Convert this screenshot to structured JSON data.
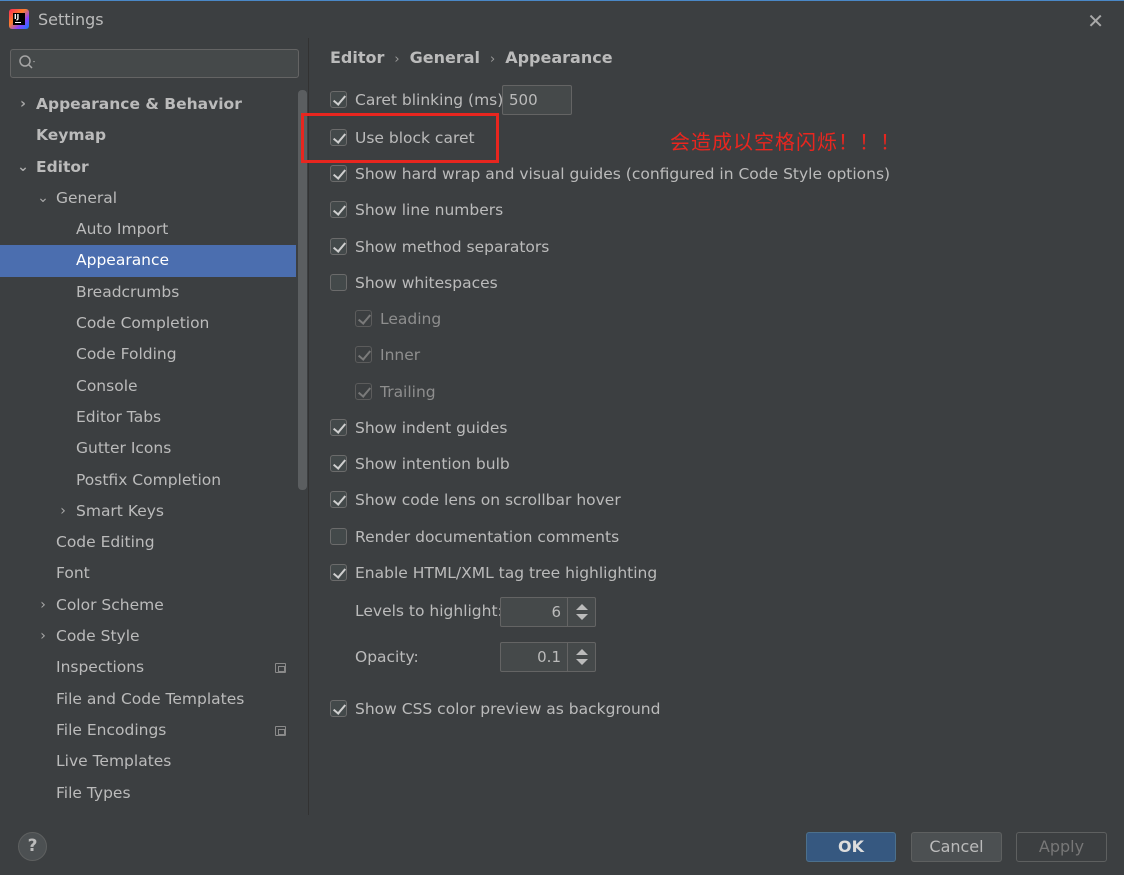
{
  "window": {
    "title": "Settings",
    "close": "✕"
  },
  "search": {
    "placeholder": "",
    "icon": "search-icon"
  },
  "tree": [
    {
      "label": "Appearance & Behavior",
      "indent": 0,
      "arrow": "›",
      "bold": true,
      "selected": false,
      "projicon": false
    },
    {
      "label": "Keymap",
      "indent": 0,
      "arrow": "",
      "bold": true,
      "selected": false,
      "projicon": false
    },
    {
      "label": "Editor",
      "indent": 0,
      "arrow": "⌄",
      "bold": true,
      "selected": false,
      "projicon": false
    },
    {
      "label": "General",
      "indent": 1,
      "arrow": "⌄",
      "bold": false,
      "selected": false,
      "projicon": false
    },
    {
      "label": "Auto Import",
      "indent": 2,
      "arrow": "",
      "bold": false,
      "selected": false,
      "projicon": false
    },
    {
      "label": "Appearance",
      "indent": 2,
      "arrow": "",
      "bold": false,
      "selected": true,
      "projicon": false
    },
    {
      "label": "Breadcrumbs",
      "indent": 2,
      "arrow": "",
      "bold": false,
      "selected": false,
      "projicon": false
    },
    {
      "label": "Code Completion",
      "indent": 2,
      "arrow": "",
      "bold": false,
      "selected": false,
      "projicon": false
    },
    {
      "label": "Code Folding",
      "indent": 2,
      "arrow": "",
      "bold": false,
      "selected": false,
      "projicon": false
    },
    {
      "label": "Console",
      "indent": 2,
      "arrow": "",
      "bold": false,
      "selected": false,
      "projicon": false
    },
    {
      "label": "Editor Tabs",
      "indent": 2,
      "arrow": "",
      "bold": false,
      "selected": false,
      "projicon": false
    },
    {
      "label": "Gutter Icons",
      "indent": 2,
      "arrow": "",
      "bold": false,
      "selected": false,
      "projicon": false
    },
    {
      "label": "Postfix Completion",
      "indent": 2,
      "arrow": "",
      "bold": false,
      "selected": false,
      "projicon": false
    },
    {
      "label": "Smart Keys",
      "indent": 2,
      "arrow": "›",
      "bold": false,
      "selected": false,
      "projicon": false
    },
    {
      "label": "Code Editing",
      "indent": 1,
      "arrow": "",
      "bold": false,
      "selected": false,
      "projicon": false
    },
    {
      "label": "Font",
      "indent": 1,
      "arrow": "",
      "bold": false,
      "selected": false,
      "projicon": false
    },
    {
      "label": "Color Scheme",
      "indent": 1,
      "arrow": "›",
      "bold": false,
      "selected": false,
      "projicon": false
    },
    {
      "label": "Code Style",
      "indent": 1,
      "arrow": "›",
      "bold": false,
      "selected": false,
      "projicon": false
    },
    {
      "label": "Inspections",
      "indent": 1,
      "arrow": "",
      "bold": false,
      "selected": false,
      "projicon": true
    },
    {
      "label": "File and Code Templates",
      "indent": 1,
      "arrow": "",
      "bold": false,
      "selected": false,
      "projicon": false
    },
    {
      "label": "File Encodings",
      "indent": 1,
      "arrow": "",
      "bold": false,
      "selected": false,
      "projicon": true
    },
    {
      "label": "Live Templates",
      "indent": 1,
      "arrow": "",
      "bold": false,
      "selected": false,
      "projicon": false
    },
    {
      "label": "File Types",
      "indent": 1,
      "arrow": "",
      "bold": false,
      "selected": false,
      "projicon": false
    }
  ],
  "breadcrumb": {
    "a": "Editor",
    "b": "General",
    "c": "Appearance",
    "sep": "›"
  },
  "caret": {
    "label": "Caret blinking (ms):",
    "value": "500"
  },
  "options": {
    "block_caret": "Use block caret",
    "hard_wrap": "Show hard wrap and visual guides (configured in Code Style options)",
    "line_numbers": "Show line numbers",
    "method_sep": "Show method separators",
    "whitespaces": "Show whitespaces",
    "leading": "Leading",
    "inner": "Inner",
    "trailing": "Trailing",
    "indent_guides": "Show indent guides",
    "intention_bulb": "Show intention bulb",
    "code_lens": "Show code lens on scrollbar hover",
    "render_docs": "Render documentation comments",
    "tag_tree": "Enable HTML/XML tag tree highlighting",
    "css_preview": "Show CSS color preview as background"
  },
  "levels": {
    "label": "Levels to highlight:",
    "value": "6"
  },
  "opacity": {
    "label": "Opacity:",
    "value": "0.1"
  },
  "annotation": "会造成以空格闪烁！！！",
  "footer": {
    "help": "?",
    "ok": "OK",
    "cancel": "Cancel",
    "apply": "Apply"
  },
  "colors": {
    "accent": "#4b6eaf",
    "highlight": "#e8261f",
    "ok_button": "#365880"
  }
}
